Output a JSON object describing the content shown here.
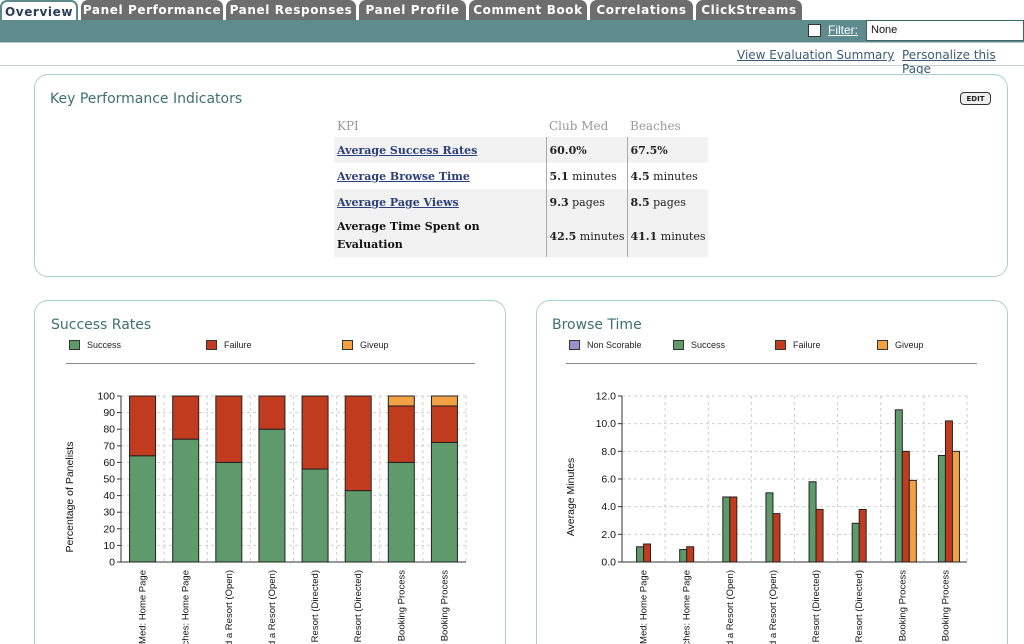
{
  "tabs": [
    {
      "label": "Overview",
      "active": true
    },
    {
      "label": "Panel Performance",
      "active": false
    },
    {
      "label": "Panel Responses",
      "active": false
    },
    {
      "label": "Panel Profile",
      "active": false
    },
    {
      "label": "Comment Book",
      "active": false
    },
    {
      "label": "Correlations",
      "active": false
    },
    {
      "label": "ClickStreams",
      "active": false
    }
  ],
  "filter": {
    "label": "Filter:",
    "value": "None"
  },
  "links": {
    "view_summary": "View Evaluation Summary",
    "personalize": "Personalize this Page"
  },
  "kpi": {
    "title": "Key Performance Indicators",
    "edit_label": "EDIT",
    "headers": [
      "KPI",
      "Club Med",
      "Beaches"
    ],
    "rows": [
      {
        "label": "Average Success Rates",
        "link": true,
        "v1": "60.0%",
        "v1u": "",
        "v2": "67.5%",
        "v2u": ""
      },
      {
        "label": "Average Browse Time",
        "link": true,
        "v1": "5.1",
        "v1u": " minutes",
        "v2": "4.5",
        "v2u": " minutes"
      },
      {
        "label": "Average Page Views",
        "link": true,
        "v1": "9.3",
        "v1u": " pages",
        "v2": "8.5",
        "v2u": " pages"
      },
      {
        "label": "Average Time Spent on Evaluation",
        "link": false,
        "v1": "42.5",
        "v1u": " minutes",
        "v2": "41.1",
        "v2u": " minutes"
      }
    ]
  },
  "colors": {
    "success": "#5f9a6a",
    "failure": "#c13b1f",
    "giveup": "#f2a245",
    "nonscorable": "#9a92c8",
    "accent": "#5f8b8e"
  },
  "chart_data": [
    {
      "type": "bar",
      "stacked": true,
      "title": "Success Rates",
      "ylabel": "Percentage of Panelists",
      "ylim": [
        0,
        100
      ],
      "yticks": [
        0,
        10,
        20,
        30,
        40,
        50,
        60,
        70,
        80,
        90,
        100
      ],
      "grid": true,
      "legend_position": "top",
      "categories": [
        "Med: Home Page",
        "aches: Home Page",
        "nd a Resort (Open)",
        "nd a Resort (Open)",
        "a Resort (Directed)",
        "a Resort (Directed)",
        "Booking Process",
        "Booking Process"
      ],
      "series": [
        {
          "name": "Success",
          "values": [
            64,
            74,
            60,
            80,
            56,
            43,
            60,
            72
          ]
        },
        {
          "name": "Failure",
          "values": [
            36,
            26,
            40,
            20,
            44,
            57,
            34,
            22
          ]
        },
        {
          "name": "Giveup",
          "values": [
            0,
            0,
            0,
            0,
            0,
            0,
            6,
            6
          ]
        }
      ]
    },
    {
      "type": "bar",
      "stacked": false,
      "title": "Browse Time",
      "ylabel": "Average Minutes",
      "ylim": [
        0,
        12
      ],
      "yticks": [
        "0.0",
        "2.0",
        "4.0",
        "6.0",
        "8.0",
        "10.0",
        "12.0"
      ],
      "grid": true,
      "legend_position": "top",
      "categories": [
        "Med: Home Page",
        "ches: Home Page",
        "d a Resort (Open)",
        "d a Resort (Open)",
        "a Resort (Directed)",
        "a Resort (Directed)",
        "Booking Process",
        "Booking Process"
      ],
      "series": [
        {
          "name": "Non Scorable",
          "values": [
            0,
            0,
            0,
            0,
            0,
            0,
            0,
            0
          ]
        },
        {
          "name": "Success",
          "values": [
            1.1,
            0.9,
            4.7,
            5.0,
            5.8,
            2.8,
            11.0,
            7.7
          ]
        },
        {
          "name": "Failure",
          "values": [
            1.3,
            1.1,
            4.7,
            3.5,
            3.8,
            3.8,
            8.0,
            10.2
          ]
        },
        {
          "name": "Giveup",
          "values": [
            0,
            0,
            0,
            0,
            0,
            0,
            5.9,
            8.0
          ]
        }
      ]
    }
  ]
}
